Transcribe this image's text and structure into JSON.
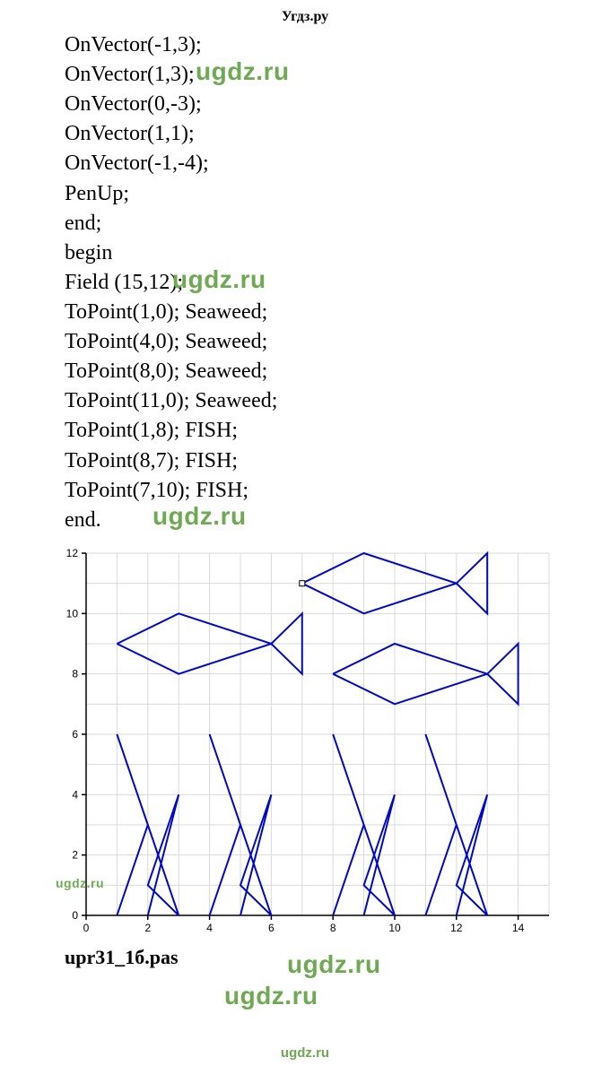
{
  "header": "Угдз.ру",
  "code": {
    "lines": [
      "OnVector(-1,3);",
      "OnVector(1,3);",
      "OnVector(0,-3);",
      "OnVector(1,1);",
      "OnVector(-1,-4);",
      "PenUp;",
      "end;",
      "begin",
      "Field (15,12);",
      "ToPoint(1,0); Seaweed;",
      "ToPoint(4,0); Seaweed;",
      "ToPoint(8,0); Seaweed;",
      "ToPoint(11,0); Seaweed;",
      "ToPoint(1,8); FISH;",
      "ToPoint(8,7); FISH;",
      "ToPoint(7,10); FISH;",
      "end."
    ]
  },
  "watermarks": {
    "w1": "ugdz.ru",
    "w2": "ugdz.ru",
    "w3": "ugdz.ru",
    "w4": "ugdz.ru",
    "w5": "ugdz.ru",
    "w6": "ugdz.ru",
    "footer": "ugdz.ru"
  },
  "file_label": "upr31_1б.pas",
  "chart_data": {
    "type": "line",
    "title": "",
    "xlabel": "",
    "ylabel": "",
    "xlim": [
      0,
      15
    ],
    "ylim": [
      0,
      12
    ],
    "xticks": [
      0,
      2,
      4,
      6,
      8,
      10,
      12,
      14
    ],
    "yticks": [
      0,
      2,
      4,
      6,
      8,
      10,
      12
    ],
    "series": [
      {
        "name": "seaweed1",
        "points": [
          [
            1,
            0
          ],
          [
            2,
            3
          ],
          [
            1,
            6
          ],
          [
            2,
            3
          ],
          [
            3,
            0
          ],
          [
            2,
            1
          ],
          [
            3,
            4
          ],
          [
            2,
            0
          ]
        ]
      },
      {
        "name": "seaweed2",
        "points": [
          [
            4,
            0
          ],
          [
            5,
            3
          ],
          [
            4,
            6
          ],
          [
            5,
            3
          ],
          [
            6,
            0
          ],
          [
            5,
            1
          ],
          [
            6,
            4
          ],
          [
            5,
            0
          ]
        ]
      },
      {
        "name": "seaweed3",
        "points": [
          [
            8,
            0
          ],
          [
            9,
            3
          ],
          [
            8,
            6
          ],
          [
            9,
            3
          ],
          [
            10,
            0
          ],
          [
            9,
            1
          ],
          [
            10,
            4
          ],
          [
            9,
            0
          ]
        ]
      },
      {
        "name": "seaweed4",
        "points": [
          [
            11,
            0
          ],
          [
            12,
            3
          ],
          [
            11,
            6
          ],
          [
            12,
            3
          ],
          [
            13,
            0
          ],
          [
            12,
            1
          ],
          [
            13,
            4
          ],
          [
            12,
            0
          ]
        ]
      },
      {
        "name": "fish1",
        "points": [
          [
            1,
            9
          ],
          [
            3,
            10
          ],
          [
            6,
            9
          ],
          [
            7,
            10
          ],
          [
            7,
            8
          ],
          [
            6,
            9
          ],
          [
            3,
            8
          ],
          [
            1,
            9
          ]
        ]
      },
      {
        "name": "fish2",
        "points": [
          [
            8,
            8
          ],
          [
            10,
            9
          ],
          [
            13,
            8
          ],
          [
            14,
            9
          ],
          [
            14,
            7
          ],
          [
            13,
            8
          ],
          [
            10,
            7
          ],
          [
            8,
            8
          ]
        ]
      },
      {
        "name": "fish3",
        "points": [
          [
            7,
            11
          ],
          [
            9,
            12
          ],
          [
            12,
            11
          ],
          [
            13,
            12
          ],
          [
            13,
            10
          ],
          [
            12,
            11
          ],
          [
            9,
            10
          ],
          [
            7,
            11
          ]
        ]
      }
    ],
    "cursor": [
      7,
      11
    ]
  }
}
